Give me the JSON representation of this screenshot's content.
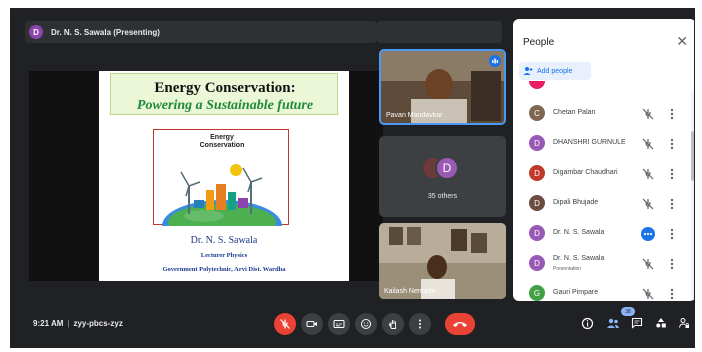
{
  "presenter": {
    "avatar_letter": "D",
    "label": "Dr. N. S. Sawala (Presenting)"
  },
  "slide": {
    "title": "Energy Conservation:",
    "subtitle": "Powering  a Sustainable future",
    "image_title_line1": "Energy",
    "image_title_line2": "Conservation",
    "author": "Dr.  N. S. Sawala",
    "role": "Lecturer Physics",
    "institute": "Government Polytechnic, Arvi Dist. Wardha"
  },
  "tiles": [
    {
      "name": "Pavan Mandavkar"
    },
    {
      "name": "35 others",
      "avatar_letter": "D"
    },
    {
      "name": "Kailash Nemade"
    }
  ],
  "people": {
    "title": "People",
    "add_label": "Add people",
    "rows": [
      {
        "name": "Chetan Palan",
        "letter": "C",
        "color": "#7d6652",
        "muted": true
      },
      {
        "name": "DHANSHRI GURNULE",
        "letter": "D",
        "color": "#9b59b6",
        "muted": true
      },
      {
        "name": "Digambar Chaudhari",
        "letter": "D",
        "color": "#c0392b",
        "muted": true
      },
      {
        "name": "Dipali Bhujade",
        "letter": "D",
        "color": "#6d4c41",
        "muted": true
      },
      {
        "name": "Dr. N. S. Sawala",
        "letter": "D",
        "color": "#9b59b6",
        "muted": false
      },
      {
        "name": "Dr. N. S. Sawala",
        "sub": "Presentation",
        "letter": "D",
        "color": "#9b59b6",
        "muted": true
      },
      {
        "name": "Gauri Pimpare",
        "letter": "G",
        "color": "#43a047",
        "muted": true
      }
    ]
  },
  "bottom_bar": {
    "time": "9:21 AM",
    "separator": "|",
    "meeting_code": "zyy-pbcs-zyz",
    "participant_count": "38"
  },
  "colors": {
    "accent": "#1a73e8",
    "end_call": "#ea4335",
    "background": "#202124"
  }
}
